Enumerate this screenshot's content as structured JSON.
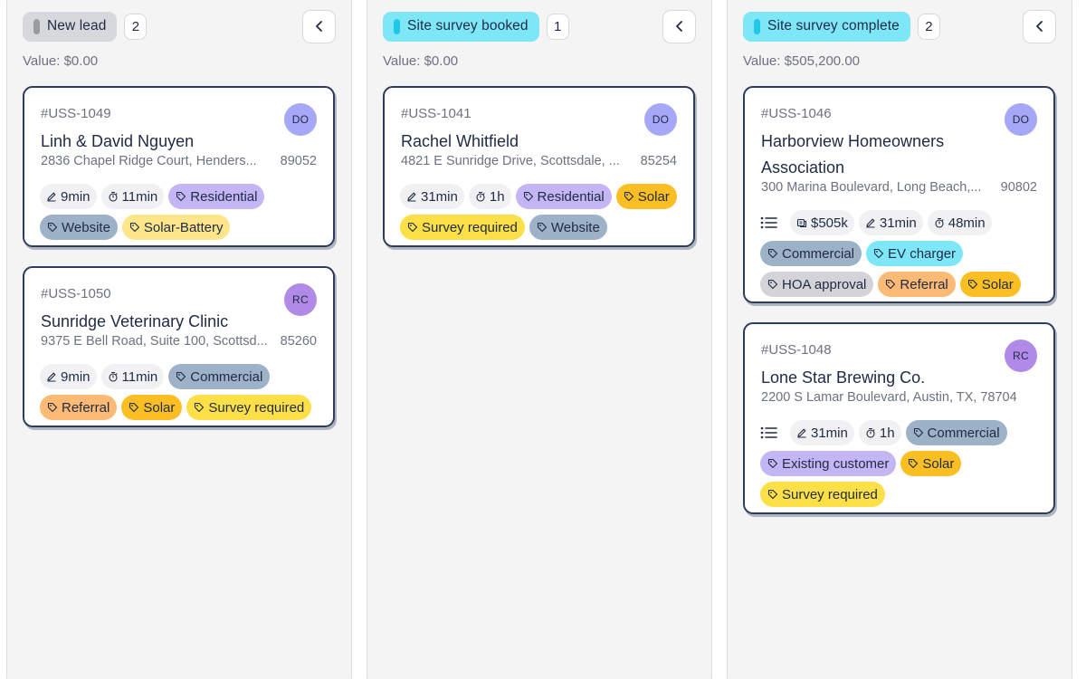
{
  "columns": [
    {
      "stage": "New lead",
      "count": "2",
      "value": "Value: $0.00",
      "stage_bg": "#d7d8dc",
      "stage_dot": "#9a9ba1",
      "cards": [
        {
          "id": "#USS-1049",
          "title": "Linh & David Nguyen",
          "address": "2836 Chapel Ridge Court, Henders...",
          "zip": "89052",
          "avatar": "DO",
          "meta": [
            {
              "icon": "pencil-icon",
              "text": "9min"
            },
            {
              "icon": "stopwatch-icon",
              "text": "11min"
            }
          ],
          "tags": [
            "Residential",
            "Website",
            "Solar-Battery"
          ]
        },
        {
          "id": "#USS-1050",
          "title": "Sunridge Veterinary Clinic",
          "address": "9375 E Bell Road, Suite 100, Scottsd...",
          "zip": "85260",
          "avatar": "RC",
          "meta": [
            {
              "icon": "pencil-icon",
              "text": "9min"
            },
            {
              "icon": "stopwatch-icon",
              "text": "11min"
            }
          ],
          "tags": [
            "Commercial",
            "Referral",
            "Solar",
            "Survey required"
          ]
        }
      ]
    },
    {
      "stage": "Site survey booked",
      "count": "1",
      "value": "Value: $0.00",
      "stage_bg": "#7ee7f7",
      "stage_dot": "#22c7e8",
      "cards": [
        {
          "id": "#USS-1041",
          "title": "Rachel Whitfield",
          "address": "4821 E Sunridge Drive, Scottsdale, ...",
          "zip": "85254",
          "avatar": "DO",
          "meta": [
            {
              "icon": "pencil-icon",
              "text": "31min"
            },
            {
              "icon": "stopwatch-icon",
              "text": "1h"
            }
          ],
          "tags": [
            "Residential",
            "Solar",
            "Survey required",
            "Website"
          ]
        }
      ]
    },
    {
      "stage": "Site survey complete",
      "count": "2",
      "value": "Value: $505,200.00",
      "stage_bg": "#7ee7f7",
      "stage_dot": "#22c7e8",
      "cards": [
        {
          "id": "#USS-1046",
          "title": "Harborview Homeowners Association",
          "address": "300 Marina Boulevard, Long Beach,...",
          "zip": "90802",
          "avatar": "DO",
          "meta": [
            {
              "icon": "checklist-icon",
              "text": ""
            },
            {
              "icon": "money-icon",
              "text": "$505k"
            },
            {
              "icon": "pencil-icon",
              "text": "31min"
            },
            {
              "icon": "stopwatch-icon",
              "text": "48min"
            }
          ],
          "tags": [
            "Commercial",
            "EV charger",
            "HOA approval",
            "Referral",
            "Solar"
          ]
        },
        {
          "id": "#USS-1048",
          "title": "Lone Star Brewing Co.",
          "address": "2200 S Lamar Boulevard, Austin, TX, 78704",
          "zip": "",
          "avatar": "RC",
          "meta": [
            {
              "icon": "checklist-icon",
              "text": ""
            },
            {
              "icon": "pencil-icon",
              "text": "31min"
            },
            {
              "icon": "stopwatch-icon",
              "text": "1h"
            }
          ],
          "tags": [
            "Commercial",
            "Existing customer",
            "Solar",
            "Survey required"
          ]
        }
      ]
    }
  ],
  "avatar_colors": {
    "DO": "#a5a7f7",
    "RC": "#b08ae6"
  },
  "tag_colors": {
    "Residential": "#c4b5f5",
    "Commercial": "#9db1c7",
    "Website": "#9db1c7",
    "Solar-Battery": "#fde68a",
    "Solar": "#fbbf24",
    "Survey required": "#fde047",
    "Referral": "#fdba74",
    "EV charger": "#7ee7f7",
    "HOA approval": "#d4d4d8",
    "Existing customer": "#c4b5f5"
  }
}
